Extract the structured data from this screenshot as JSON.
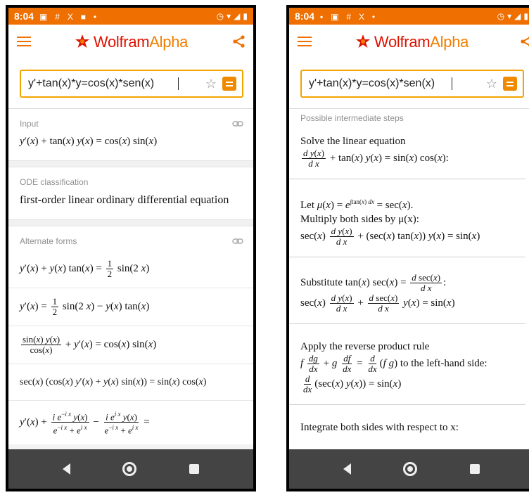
{
  "status": {
    "time": "8:04"
  },
  "brand": {
    "name_part1": "Wolfram",
    "name_part2": "Alpha"
  },
  "search": {
    "query_left": "y'+tan(x)*y=cos(x)*sen(x)",
    "query_right": "y'+tan(x)*y=cos(x)*sen(x)"
  },
  "left": {
    "input_pod": {
      "title": "Input"
    },
    "ode_pod": {
      "title": "ODE classification",
      "value": "first-order linear ordinary differential equation"
    },
    "alt_pod": {
      "title": "Alternate forms"
    }
  },
  "right": {
    "steps_title": "Possible intermediate steps",
    "step1": {
      "text": "Solve the linear equation"
    },
    "step2": {
      "text_a": "Multiply both sides by μ(x):"
    },
    "step4": {
      "text": "Apply the reverse product rule",
      "text_b": "to the left-hand side:"
    },
    "step5": {
      "text": "Integrate both sides with respect to x:"
    }
  },
  "icons": {
    "menu": "menu-icon",
    "share": "share-icon",
    "star": "star-icon",
    "keyboard": "equals-keyboard-icon",
    "link": "link-icon",
    "back": "back-icon",
    "home": "home-icon",
    "recent": "recent-apps-icon"
  },
  "colors": {
    "accent": "#ef6f00",
    "brand_red": "#dd1100",
    "search_border": "#f3a400",
    "nav_bg": "#444444"
  }
}
